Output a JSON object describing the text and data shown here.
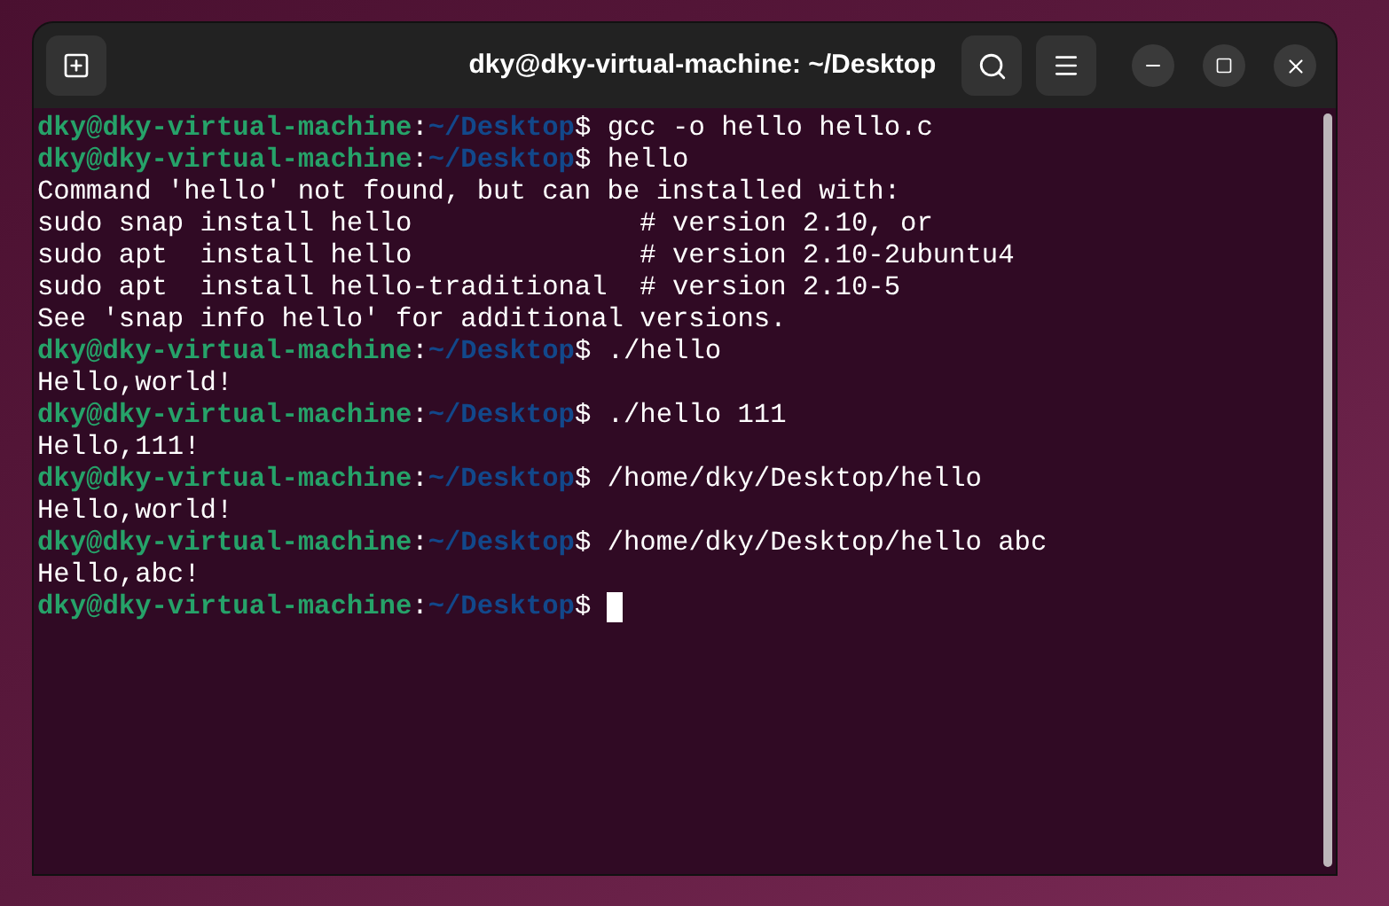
{
  "window": {
    "title": "dky@dky-virtual-machine: ~/Desktop"
  },
  "lines": [
    {
      "kind": "prompt",
      "host": "dky@dky-virtual-machine",
      "separator": ":",
      "path": "~/Desktop",
      "symbol": "$",
      "command": " gcc -o hello hello.c"
    },
    {
      "kind": "prompt",
      "host": "dky@dky-virtual-machine",
      "separator": ":",
      "path": "~/Desktop",
      "symbol": "$",
      "command": " hello"
    },
    {
      "kind": "output",
      "text": "Command 'hello' not found, but can be installed with:"
    },
    {
      "kind": "output",
      "text": "sudo snap install hello              # version 2.10, or"
    },
    {
      "kind": "output",
      "text": "sudo apt  install hello              # version 2.10-2ubuntu4"
    },
    {
      "kind": "output",
      "text": "sudo apt  install hello-traditional  # version 2.10-5"
    },
    {
      "kind": "output",
      "text": "See 'snap info hello' for additional versions."
    },
    {
      "kind": "prompt",
      "host": "dky@dky-virtual-machine",
      "separator": ":",
      "path": "~/Desktop",
      "symbol": "$",
      "command": " ./hello"
    },
    {
      "kind": "output",
      "text": "Hello,world!"
    },
    {
      "kind": "prompt",
      "host": "dky@dky-virtual-machine",
      "separator": ":",
      "path": "~/Desktop",
      "symbol": "$",
      "command": " ./hello 111"
    },
    {
      "kind": "output",
      "text": "Hello,111!"
    },
    {
      "kind": "prompt",
      "host": "dky@dky-virtual-machine",
      "separator": ":",
      "path": "~/Desktop",
      "symbol": "$",
      "command": " /home/dky/Desktop/hello"
    },
    {
      "kind": "output",
      "text": "Hello,world!"
    },
    {
      "kind": "prompt",
      "host": "dky@dky-virtual-machine",
      "separator": ":",
      "path": "~/Desktop",
      "symbol": "$",
      "command": " /home/dky/Desktop/hello abc"
    },
    {
      "kind": "output",
      "text": "Hello,abc!"
    },
    {
      "kind": "prompt",
      "host": "dky@dky-virtual-machine",
      "separator": ":",
      "path": "~/Desktop",
      "symbol": "$",
      "cursor": true
    }
  ]
}
